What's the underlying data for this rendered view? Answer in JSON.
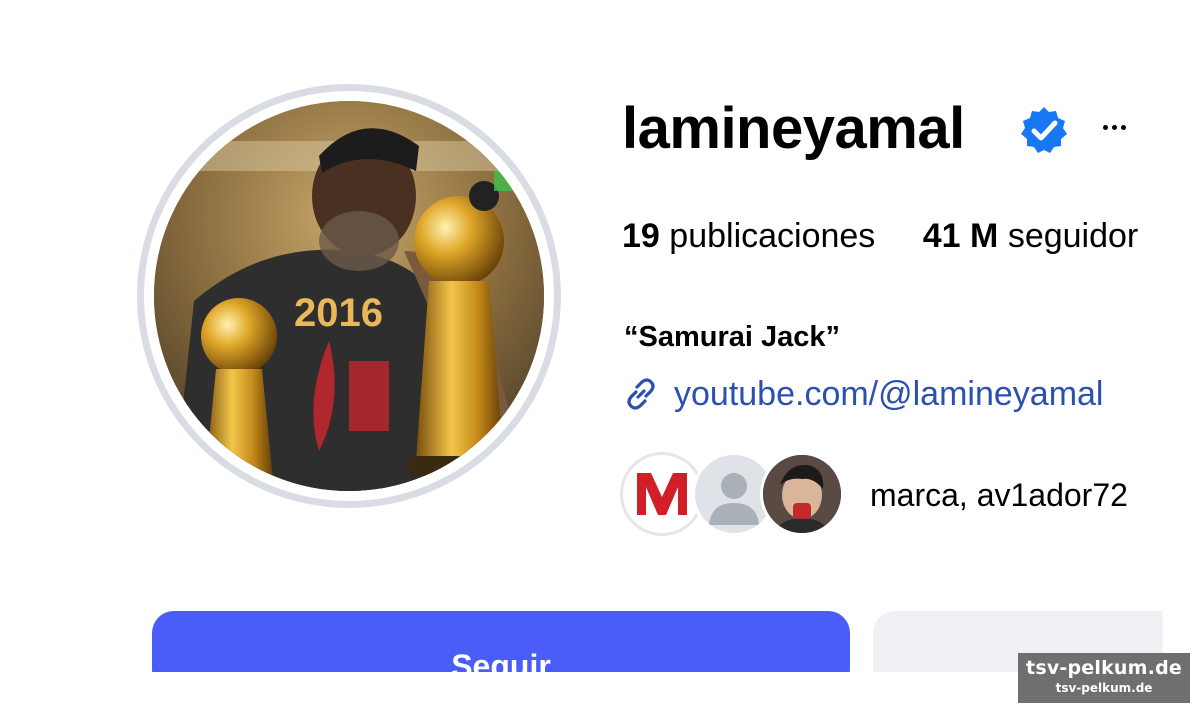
{
  "profile": {
    "username": "lamineyamal",
    "verified_icon": "verified-badge-icon",
    "more_icon": "more-options-icon",
    "stats": {
      "posts_count": "19",
      "posts_label": "publicaciones",
      "followers_count": "41 M",
      "followers_label": "seguidor"
    },
    "bio": {
      "name": "“Samurai Jack”",
      "link_icon": "link-icon",
      "link_text": "youtube.com/@lamineyamal"
    },
    "followed_by": {
      "avatars": [
        "marca-logo-avatar",
        "default-avatar",
        "user-photo-avatar"
      ],
      "text": "marca, av1ador72"
    }
  },
  "actions": {
    "follow_label": "Seguir"
  },
  "watermark": {
    "line1": "tsv-pelkum.de",
    "line2": "tsv-pelkum.de"
  },
  "colors": {
    "follow_button": "#4a5df9",
    "link": "#2c4fb2",
    "verified": "#1877f2",
    "secondary_button": "#eff1f4"
  }
}
